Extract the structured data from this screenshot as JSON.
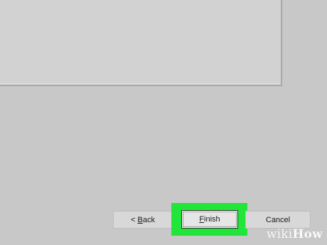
{
  "colors": {
    "background": "#c8c8c8",
    "panel": "#d2d2d2",
    "highlight": "#22e53a"
  },
  "buttons": {
    "back": {
      "prefix": "< ",
      "accel": "B",
      "rest": "ack"
    },
    "finish": {
      "accel": "F",
      "rest": "inish"
    },
    "cancel": {
      "label": "Cancel"
    }
  },
  "watermark": {
    "part1": "wiki",
    "part2": "How"
  }
}
